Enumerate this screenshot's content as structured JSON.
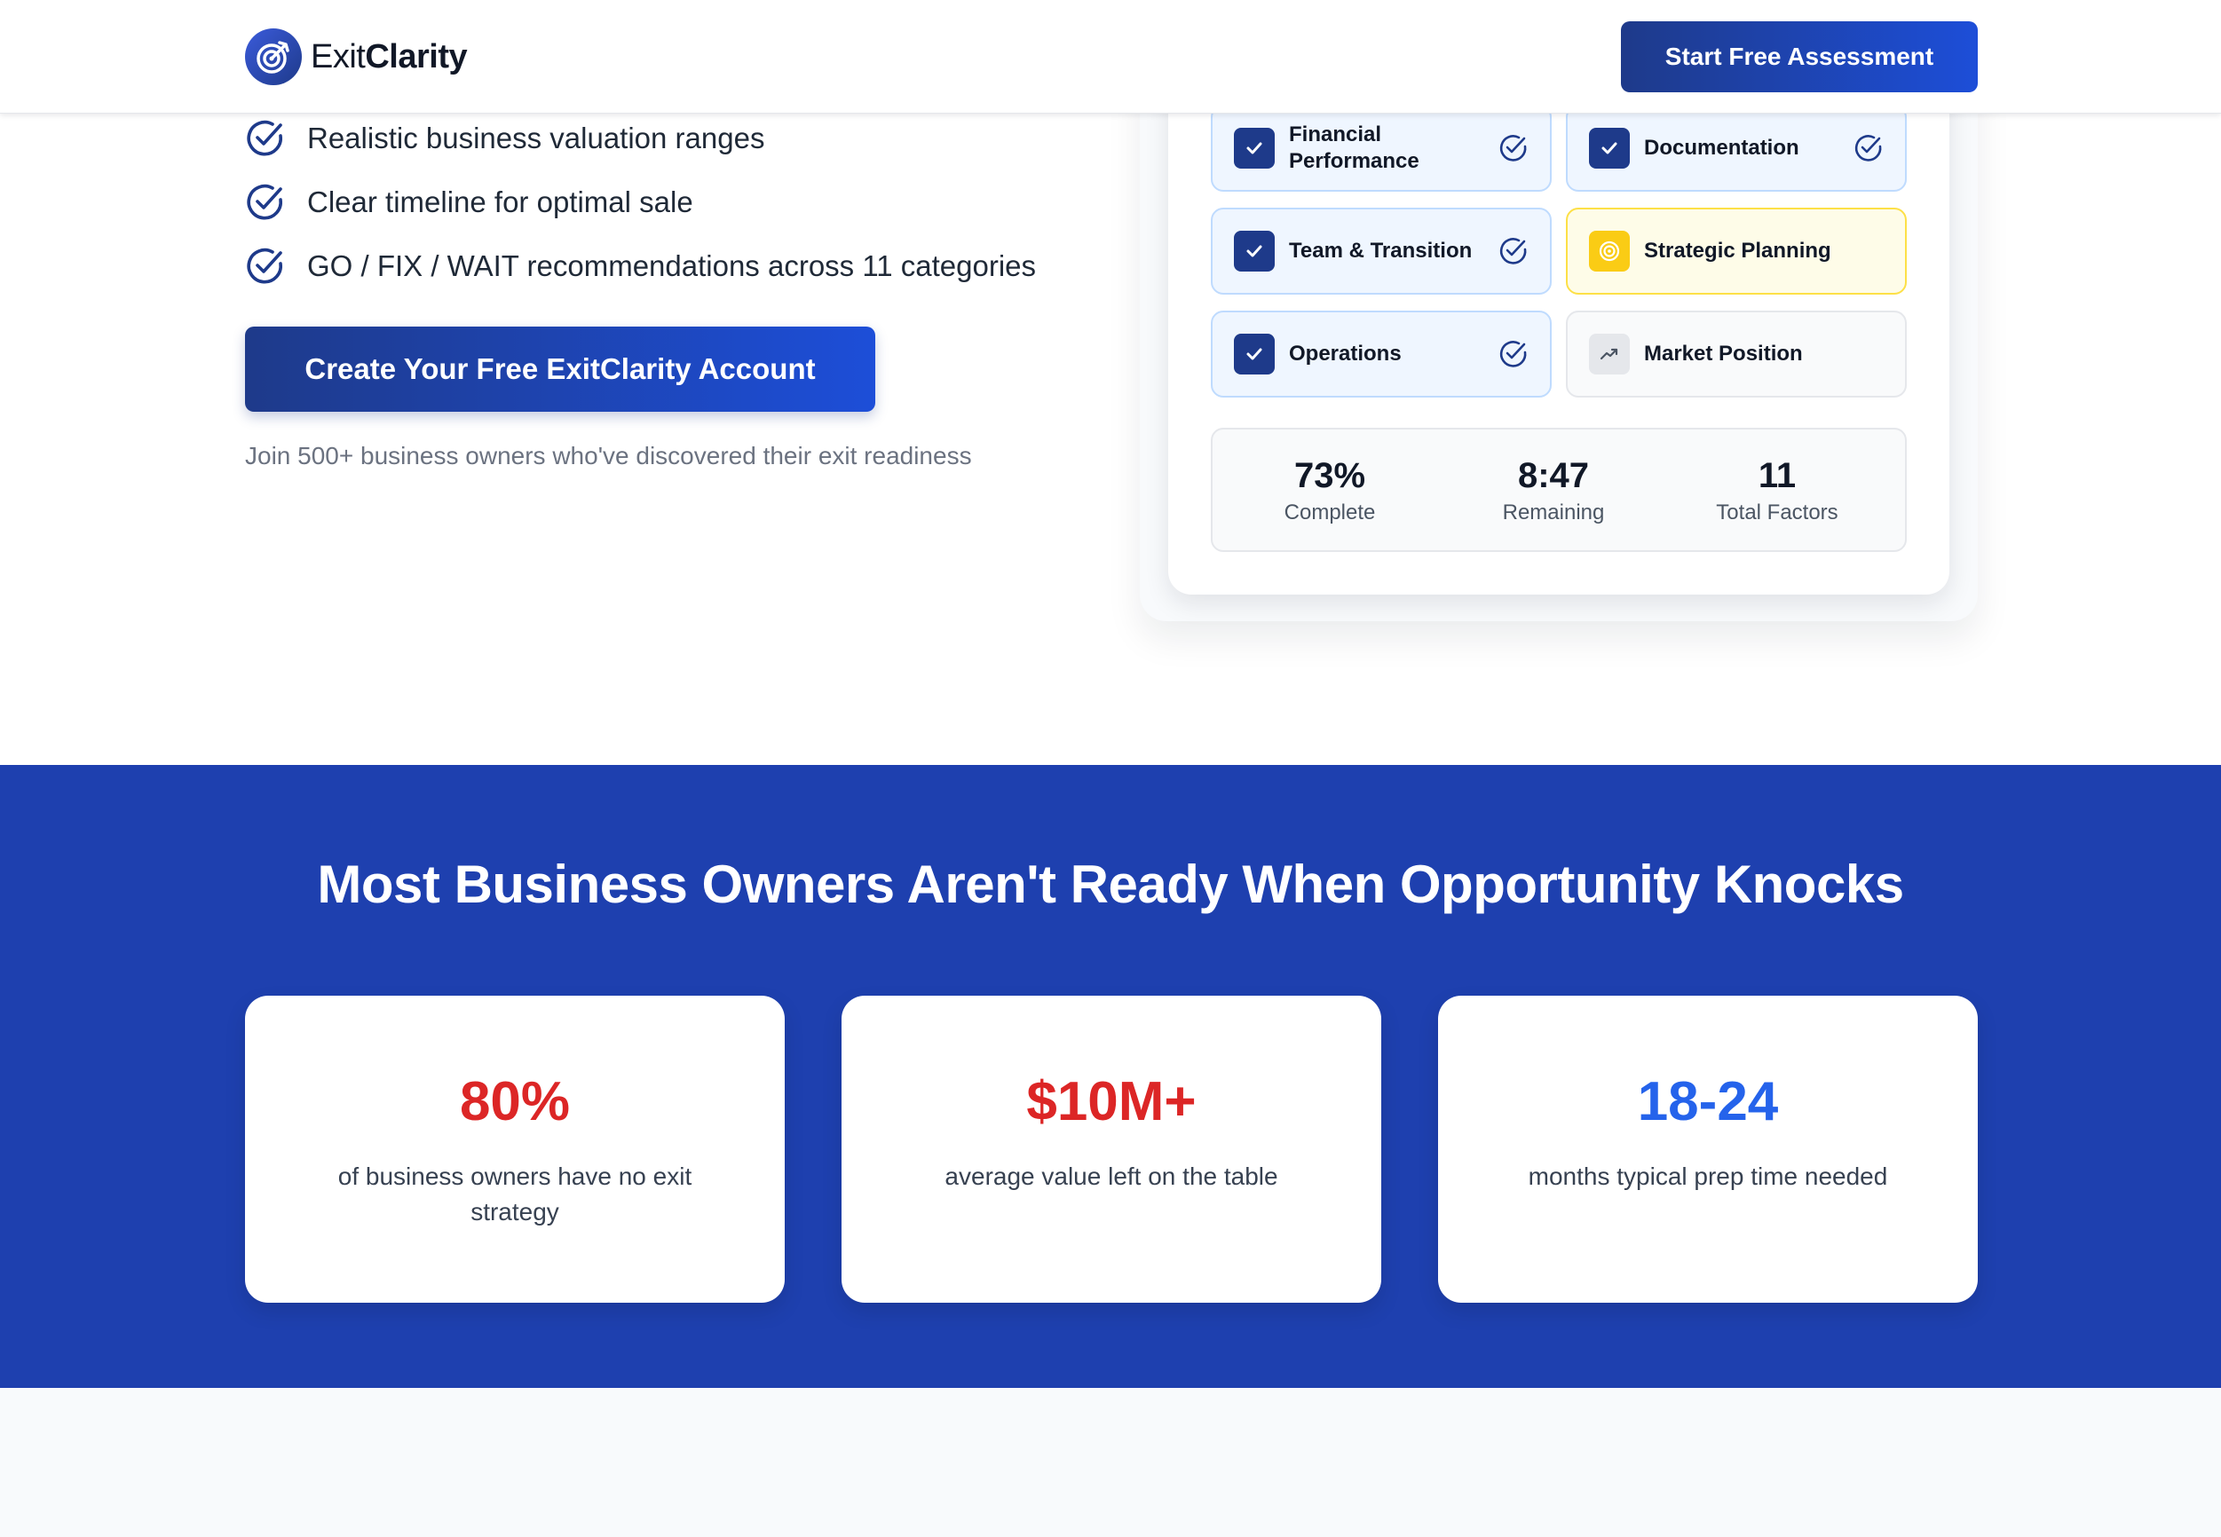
{
  "header": {
    "logo_prefix": "Exit",
    "logo_suffix": "Clarity",
    "cta_label": "Start Free Assessment"
  },
  "hero": {
    "benefits": [
      "Realistic business valuation ranges",
      "Clear timeline for optimal sale",
      "GO / FIX / WAIT recommendations across 11 categories"
    ],
    "cta_label": "Create Your Free ExitClarity Account",
    "note": "Join 500+ business owners who've discovered their exit readiness"
  },
  "assessment": {
    "categories": [
      {
        "label": "Financial Performance",
        "status": "complete"
      },
      {
        "label": "Documentation",
        "status": "complete"
      },
      {
        "label": "Team & Transition",
        "status": "complete"
      },
      {
        "label": "Strategic Planning",
        "status": "in-progress"
      },
      {
        "label": "Operations",
        "status": "complete"
      },
      {
        "label": "Market Position",
        "status": "pending"
      }
    ],
    "stats": [
      {
        "value": "73%",
        "label": "Complete"
      },
      {
        "value": "8:47",
        "label": "Remaining"
      },
      {
        "value": "11",
        "label": "Total Factors"
      }
    ]
  },
  "problem": {
    "heading": "Most Business Owners Aren't Ready When Opportunity Knocks",
    "stats": [
      {
        "value": "80%",
        "label": "of business owners have no exit strategy",
        "color": "#dc2626"
      },
      {
        "value": "$10M+",
        "label": "average value left on the table",
        "color": "#dc2626"
      },
      {
        "value": "18-24",
        "label": "months typical prep time needed",
        "color": "#2563eb"
      }
    ]
  },
  "colors": {
    "brand_navy": "#1e3a8a",
    "brand_blue": "#1d4ed8",
    "section_blue": "#1e40af",
    "highlight_yellow": "#facc15",
    "stat_red": "#dc2626",
    "stat_blue": "#2563eb"
  },
  "icons": {
    "logo": "target-arrow-icon",
    "benefit": "check-circle-icon",
    "category_done": "check-box-icon",
    "category_in_progress": "target-icon",
    "category_pending": "trending-up-icon",
    "category_complete_badge": "check-circle-icon"
  }
}
